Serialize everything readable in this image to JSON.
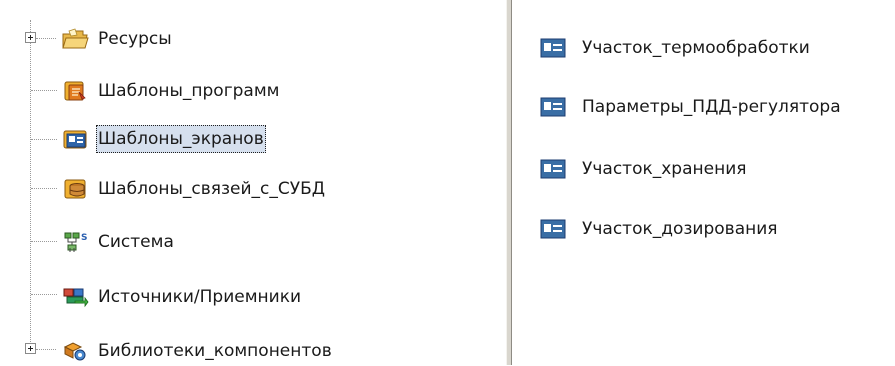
{
  "tree": {
    "items": [
      {
        "label": "Ресурсы",
        "icon": "folder-resources-icon",
        "expandable": true
      },
      {
        "label": "Шаблоны_программ",
        "icon": "program-templates-icon",
        "expandable": false
      },
      {
        "label": "Шаблоны_экранов",
        "icon": "screen-templates-icon",
        "expandable": false,
        "selected": true
      },
      {
        "label": "Шаблоны_связей_с_СУБД",
        "icon": "dbms-templates-icon",
        "expandable": false
      },
      {
        "label": "Система",
        "icon": "system-network-icon",
        "expandable": false
      },
      {
        "label": "Источники/Приемники",
        "icon": "sources-receivers-icon",
        "expandable": false
      },
      {
        "label": "Библиотеки_компонентов",
        "icon": "component-library-icon",
        "expandable": true
      }
    ]
  },
  "list": {
    "items": [
      {
        "label": "Участок_термообработки",
        "icon": "screen-icon"
      },
      {
        "label": "Параметры_ПДД-регулятора",
        "icon": "screen-icon"
      },
      {
        "label": "Участок_хранения",
        "icon": "screen-icon"
      },
      {
        "label": "Участок_дозирования",
        "icon": "screen-icon"
      }
    ]
  },
  "colors": {
    "selection": "#d6e0ee",
    "splitter": "#d9d6ce",
    "screen_icon_blue": "#3a6ea5"
  }
}
